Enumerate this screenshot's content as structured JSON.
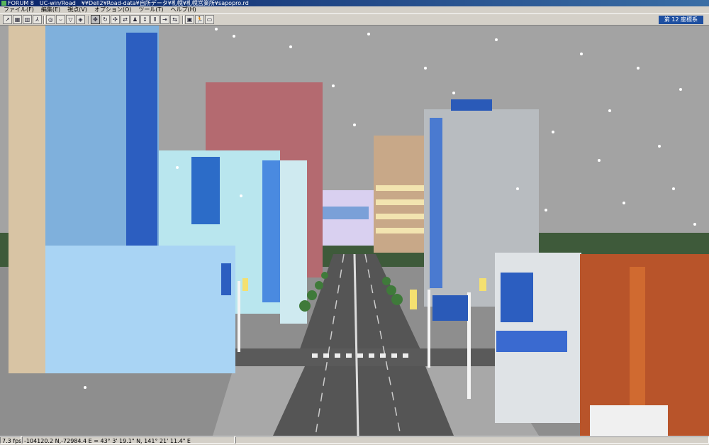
{
  "window": {
    "app_name": "FORUM 8",
    "product": "UC-win/Road",
    "file_path": "¥¥Dell2¥Road-data¥自所データ¥札幌¥札幌営業所¥sapopro.rd"
  },
  "menu": [
    {
      "label": "ファイル(F)"
    },
    {
      "label": "編集(E)"
    },
    {
      "label": "視点(V)"
    },
    {
      "label": "オプション(O)"
    },
    {
      "label": "ツール(T)"
    },
    {
      "label": "ヘルプ(H)"
    }
  ],
  "toolbar": {
    "coordinate_system": "第 12 座標系",
    "buttons": [
      {
        "icon": "road-edit-icon",
        "glyph": "↗"
      },
      {
        "icon": "terrain-icon",
        "glyph": "▦"
      },
      {
        "icon": "grid-icon",
        "glyph": "▥"
      },
      {
        "icon": "person-icon",
        "glyph": "⅄"
      },
      {
        "icon": "globe-icon",
        "glyph": "◎"
      },
      {
        "icon": "boat-icon",
        "glyph": "⌣"
      },
      {
        "icon": "sign-icon",
        "glyph": "▽"
      },
      {
        "icon": "traffic-icon",
        "glyph": "◈"
      },
      {
        "icon": "move-icon",
        "glyph": "✥"
      },
      {
        "icon": "rotate-icon",
        "glyph": "↻"
      },
      {
        "icon": "pan-icon",
        "glyph": "✣"
      },
      {
        "icon": "drive-icon",
        "glyph": "⇄"
      },
      {
        "icon": "walk-icon",
        "glyph": "♟"
      },
      {
        "icon": "up-down-icon",
        "glyph": "↕"
      },
      {
        "icon": "pause-icon",
        "glyph": "Ⅱ"
      },
      {
        "icon": "step-icon",
        "glyph": "⇥"
      },
      {
        "icon": "scenario-icon",
        "glyph": "⇆"
      },
      {
        "icon": "camera-icon",
        "glyph": "▣"
      },
      {
        "icon": "runner-icon",
        "glyph": "🏃"
      },
      {
        "icon": "screen-icon",
        "glyph": "▭"
      }
    ]
  },
  "status": {
    "fps": "7.3 fps",
    "coordinates": "-104120.2 N,-72984.4 E = 43° 3' 19.1\" N, 141° 21' 11.4\" E"
  },
  "colors": {
    "sky": "#a3a3a3",
    "road": "#555555",
    "sidewalk": "#9c9c9c",
    "accent_title": "#0a246a",
    "coord_badge": "#1e4fa0"
  }
}
